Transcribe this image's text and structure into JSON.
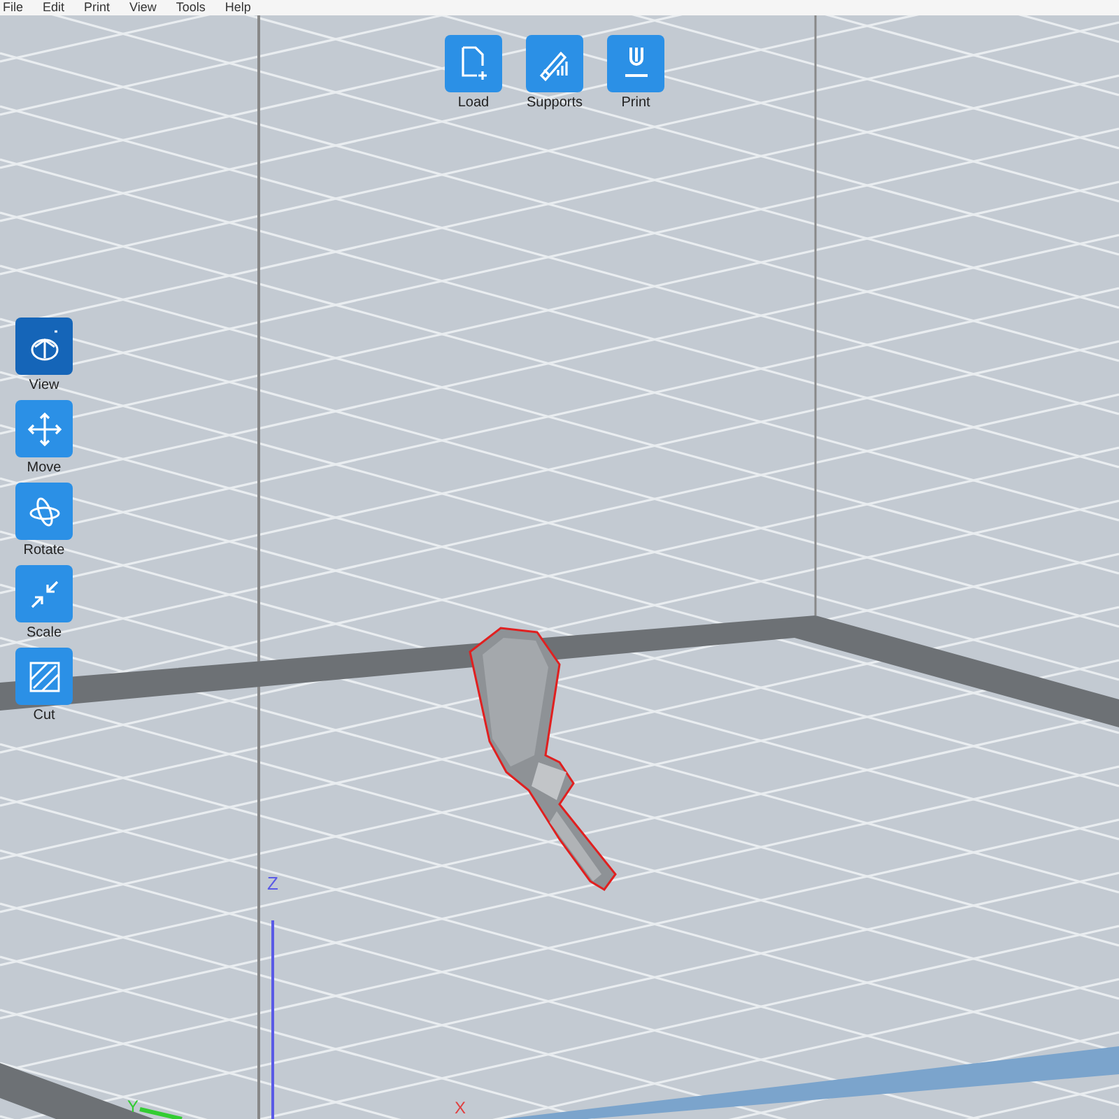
{
  "menu": [
    "File",
    "Edit",
    "Print",
    "View",
    "Tools",
    "Help"
  ],
  "top_toolbar": [
    {
      "label": "Load",
      "kind": "load"
    },
    {
      "label": "Supports",
      "kind": "supports"
    },
    {
      "label": "Print",
      "kind": "print"
    }
  ],
  "side_toolbar": [
    {
      "label": "View",
      "kind": "view",
      "selected": true
    },
    {
      "label": "Move",
      "kind": "move",
      "selected": false
    },
    {
      "label": "Rotate",
      "kind": "rotate",
      "selected": false
    },
    {
      "label": "Scale",
      "kind": "scale",
      "selected": false
    },
    {
      "label": "Cut",
      "kind": "cut",
      "selected": false
    }
  ],
  "axes": {
    "z": "Z",
    "y": "Y",
    "x": "X"
  }
}
